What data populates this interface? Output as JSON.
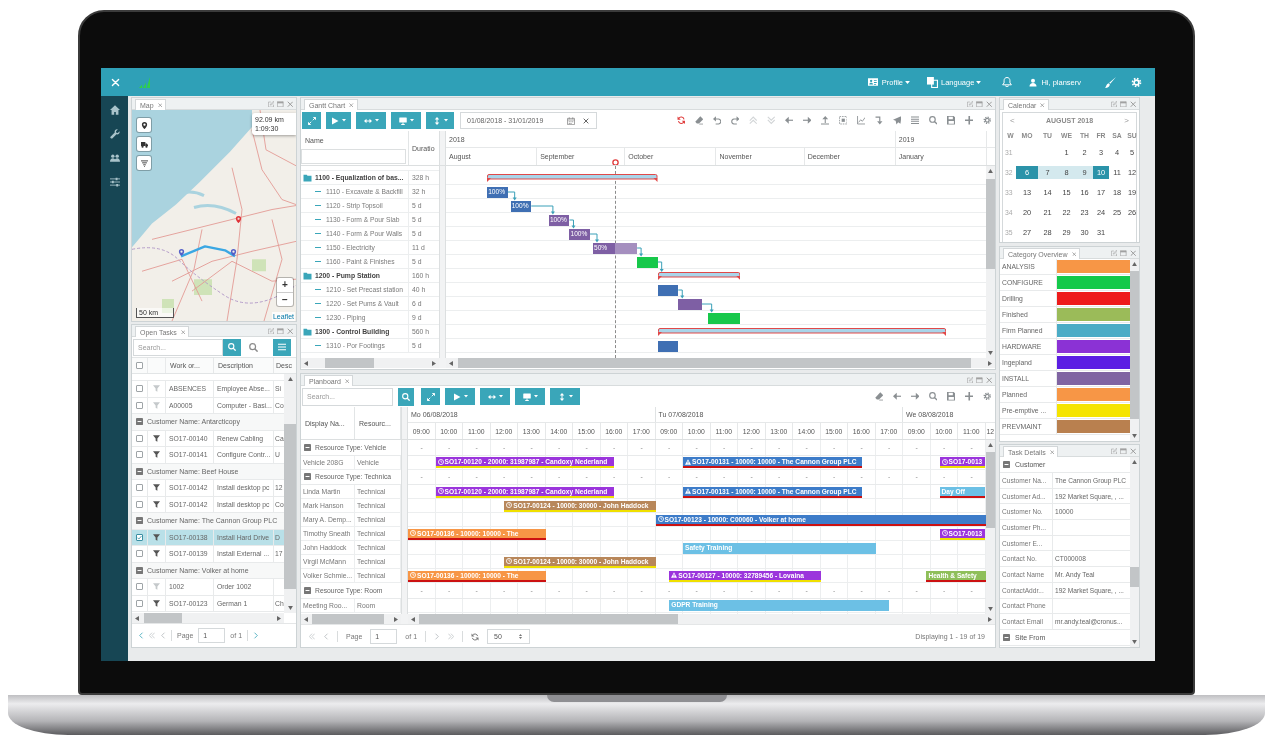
{
  "top_bar": {
    "menus": [
      {
        "label": "Profile"
      },
      {
        "label": "Language"
      }
    ],
    "user": "Hi, planserv"
  },
  "map_panel": {
    "title": "Map",
    "route_popup": {
      "distance": "92.09 km",
      "duration": "1:09:30"
    },
    "zoom_in": "+",
    "zoom_out": "−",
    "scale": "50 km",
    "attribution": "Leaflet"
  },
  "open_tasks": {
    "title": "Open Tasks",
    "search": {
      "placeholder": "Search..."
    },
    "header_checked": false,
    "columns": [
      "Work or...",
      "Description",
      "Desc"
    ],
    "rows": [
      {
        "kind": "task",
        "checked": false,
        "selected": false,
        "filter_active": false,
        "cells": [
          "ABSENCES",
          "Employee Abse...",
          "Si"
        ]
      },
      {
        "kind": "task",
        "checked": false,
        "selected": false,
        "filter_active": false,
        "cells": [
          "A00005",
          "Computer - Basi...",
          "Co"
        ]
      },
      {
        "kind": "group",
        "expanded": true,
        "label": "Customer Name: Antarcticopy"
      },
      {
        "kind": "task",
        "checked": false,
        "selected": false,
        "filter_active": true,
        "cells": [
          "SO17-00140",
          "Renew Cabling",
          "Ca"
        ]
      },
      {
        "kind": "task",
        "checked": false,
        "selected": false,
        "filter_active": true,
        "cells": [
          "SO17-00141",
          "Configure Contr...",
          "U"
        ]
      },
      {
        "kind": "group",
        "expanded": true,
        "label": "Customer Name: Beef House"
      },
      {
        "kind": "task",
        "checked": false,
        "selected": false,
        "filter_active": true,
        "cells": [
          "SO17-00142",
          "Install desktop pc",
          "12"
        ]
      },
      {
        "kind": "task",
        "checked": false,
        "selected": false,
        "filter_active": true,
        "cells": [
          "SO17-00142",
          "Install desktop pc",
          "Co"
        ]
      },
      {
        "kind": "group",
        "expanded": true,
        "label": "Customer Name: The Cannon Group PLC"
      },
      {
        "kind": "task",
        "checked": true,
        "selected": true,
        "filter_active": true,
        "cells": [
          "SO17-00138",
          "Install Hard Drive",
          "D"
        ]
      },
      {
        "kind": "task",
        "checked": false,
        "selected": false,
        "filter_active": true,
        "cells": [
          "SO17-00139",
          "Install External ...",
          "17"
        ]
      },
      {
        "kind": "group",
        "expanded": true,
        "label": "Customer Name: Volker at home"
      },
      {
        "kind": "task",
        "checked": false,
        "selected": false,
        "filter_active": false,
        "cells": [
          "1002",
          "Order 1002"
        ]
      },
      {
        "kind": "task",
        "checked": false,
        "selected": false,
        "filter_active": true,
        "cells": [
          "SO17-00123",
          "German 1",
          "Ch"
        ]
      }
    ],
    "pager": {
      "label": "Page",
      "page": "1",
      "of": "of 1"
    }
  },
  "gantt": {
    "title": "Gantt Chart",
    "date_range": "01/08/2018 - 31/01/2019",
    "tools": [
      {
        "disabled": false
      },
      {
        "disabled": false
      },
      {
        "disabled": false
      },
      {
        "disabled": false
      },
      {
        "disabled": true
      },
      {
        "disabled": true
      },
      {
        "disabled": false
      },
      {
        "disabled": false
      },
      {
        "disabled": false
      },
      {
        "disabled": false
      },
      {
        "disabled": false
      },
      {
        "disabled": false
      },
      {
        "disabled": false
      },
      {
        "disabled": false
      },
      {
        "disabled": false
      },
      {
        "disabled": false
      },
      {
        "disabled": false
      },
      {
        "disabled": false
      }
    ],
    "columns": [
      "Name",
      "Duratio"
    ],
    "timeline": {
      "years": [
        "2018",
        "2019"
      ],
      "months": [
        "August",
        "September",
        "October",
        "November",
        "December",
        "January"
      ]
    },
    "tasks": [
      {
        "name": "1100 - Equalization of bas...",
        "duration": "328 h",
        "children": [
          {
            "name": "1110 - Excavate & Backfill",
            "duration": "32 h",
            "color": "#3f6fb3",
            "level": 1,
            "progress_label": "100%"
          },
          {
            "name": "1120 - Strip Topsoil",
            "duration": "5 d",
            "color": "#3f6fb3",
            "level": 1,
            "progress_label": "100%"
          },
          {
            "name": "1130 - Form & Pour Slab",
            "duration": "5 d",
            "color": "#7e5fa4",
            "level": 1,
            "progress_label": "100%"
          },
          {
            "name": "1140 - Form & Pour Walls",
            "duration": "5 d",
            "color": "#7e5fa4",
            "level": 1,
            "progress_label": "100%"
          },
          {
            "name": "1150 - Electricity",
            "duration": "11 d",
            "color": "#7e5fa4",
            "level": 0.5,
            "progress_label": "50%"
          },
          {
            "name": "1160 - Paint & Finishes",
            "duration": "5 d",
            "color": "#17c84b"
          }
        ]
      },
      {
        "name": "1200 - Pump Station",
        "duration": "160 h",
        "children": [
          {
            "name": "1210 - Set Precast station",
            "duration": "40 h",
            "color": "#3f6fb3"
          },
          {
            "name": "1220 - Set Pums & Vault",
            "duration": "6 d",
            "color": "#7e5fa4"
          },
          {
            "name": "1230 - Piping",
            "duration": "9 d",
            "color": "#17c84b"
          }
        ]
      },
      {
        "name": "1300 - Control Building",
        "duration": "560 h",
        "children": [
          {
            "name": "1310 - Por Footings",
            "duration": "5 d",
            "color": "#3f6fb3"
          }
        ]
      }
    ]
  },
  "planboard": {
    "title": "Planboard",
    "search": {
      "placeholder": "Search..."
    },
    "columns": [
      "Display Na...",
      "Resourc..."
    ],
    "days": [
      {
        "label": "Mo 06/08/2018",
        "hours": [
          "09:00",
          "10:00",
          "11:00",
          "12:00",
          "13:00",
          "14:00",
          "15:00",
          "16:00",
          "17:00"
        ]
      },
      {
        "label": "Tu 07/08/2018",
        "hours": [
          "09:00",
          "10:00",
          "11:00",
          "12:00",
          "13:00",
          "14:00",
          "15:00",
          "16:00",
          "17:00"
        ]
      },
      {
        "label": "We 08/08/2018",
        "hours": [
          "09:00",
          "10:00",
          "11:00",
          "12"
        ]
      }
    ],
    "rows": [
      {
        "kind": "group",
        "expanded": true,
        "label": "Resource Type: Vehicle",
        "cells": [
          "-",
          "-",
          "-",
          "-",
          "-",
          "-",
          "-",
          "-",
          "-",
          "-",
          "-",
          "-",
          "-",
          "-",
          "-",
          "-",
          "-",
          "-",
          "-",
          "-",
          "-"
        ]
      },
      {
        "kind": "resource",
        "name": "Vehicle 208G",
        "type": "Vehicle",
        "events": [
          {
            "kind": "order",
            "label": "SO17-00120 - 20000: 31987987 - Candoxy Nederland",
            "color": "#9b35dc",
            "underline": {
              "color": "#f0e000"
            }
          },
          {
            "kind": "alert",
            "label": "SO17-00131 - 10000: 10000 - The Cannon Group PLC",
            "color": "#3d7cc9",
            "underline": {
              "color": "#cc1111"
            }
          },
          {
            "kind": "order",
            "label": "SO17-0013",
            "color": "#9b35dc",
            "underline": {
              "color": "#f0e000"
            }
          }
        ]
      },
      {
        "kind": "group",
        "expanded": true,
        "label": "Resource Type: Technica",
        "cells": [
          "-",
          "-",
          "-",
          "-",
          "-",
          "-",
          "-",
          "-",
          "-",
          "-",
          "-",
          "-",
          "-",
          "-",
          "-",
          "-",
          "-",
          "-",
          "-",
          "-",
          "-"
        ]
      },
      {
        "kind": "resource",
        "name": "Linda Martin",
        "type": "Technical",
        "events": [
          {
            "kind": "order",
            "label": "SO17-00120 - 20000: 31987987 - Candoxy Nederland",
            "color": "#9b35dc",
            "underline": {
              "color": "#f0e000"
            }
          },
          {
            "kind": "alert",
            "label": "SO17-00131 - 10000: 10000 - The Cannon Group PLC",
            "color": "#3d7cc9",
            "underline": {
              "color": "#cc1111"
            }
          },
          {
            "kind": "activity",
            "label": "Day Off",
            "color": "#6cc0e5",
            "underline": {
              "color": "#cc1111"
            }
          }
        ]
      },
      {
        "kind": "resource",
        "name": "Mark Hanson",
        "type": "Technical",
        "events": [
          {
            "kind": "order",
            "label": "SO17-00124 - 10000: 30000 - John Haddock",
            "color": "#b8875a",
            "underline": {
              "color": "#f0e000"
            }
          }
        ]
      },
      {
        "kind": "resource",
        "name": "Mary A. Demp...",
        "type": "Technical",
        "events": [
          {
            "kind": "order",
            "label": "SO17-00123 - 10000: C00060 - Volker at home",
            "color": "#3d7cc9",
            "underline": {
              "color": "#cc1111"
            }
          }
        ]
      },
      {
        "kind": "resource",
        "name": "Timothy Sneath",
        "type": "Technical",
        "events": [
          {
            "kind": "order",
            "label": "SO17-00136 - 10000: 10000 - The",
            "color": "#f79646",
            "underline": {
              "color": "#cc1111"
            }
          },
          {
            "kind": "order",
            "label": "SO17-0013",
            "color": "#9b35dc",
            "underline": {
              "color": "#f0e000"
            }
          }
        ]
      },
      {
        "kind": "resource",
        "name": "John Haddock",
        "type": "Technical",
        "events": [
          {
            "kind": "activity",
            "label": "Safety Training",
            "color": "#6cc0e5"
          }
        ]
      },
      {
        "kind": "resource",
        "name": "Virgil McMann",
        "type": "Technical",
        "events": [
          {
            "kind": "order",
            "label": "SO17-00124 - 10000: 30000 - John Haddock",
            "color": "#b8875a",
            "underline": {
              "color": "#f0e000"
            }
          }
        ]
      },
      {
        "kind": "resource",
        "name": "Volker Schmie...",
        "type": "Technical",
        "events": [
          {
            "kind": "order",
            "label": "SO17-00136 - 10000: 10000 - The",
            "color": "#f79646",
            "underline": {
              "color": "#cc1111"
            }
          },
          {
            "kind": "alert",
            "label": "SO17-00127 - 10000: 32789456 - Lovaina",
            "color": "#9b35dc",
            "underline": {
              "color": "#f0e000"
            }
          },
          {
            "kind": "activity",
            "label": "Health & Safety",
            "color": "#8fbf5a",
            "underline": {
              "color": "#cc1111"
            }
          }
        ]
      },
      {
        "kind": "group",
        "expanded": true,
        "label": "Resource Type: Room",
        "cells": [
          "-",
          "-",
          "-",
          "-",
          "-",
          "-",
          "-",
          "-",
          "-",
          "-",
          "-",
          "-",
          "-",
          "-",
          "-",
          "-",
          "-",
          "-",
          "-",
          "-",
          "-"
        ]
      },
      {
        "kind": "resource",
        "name": "Meeting Roo...",
        "type": "Room",
        "events": [
          {
            "kind": "activity",
            "label": "GDPR Training",
            "color": "#6cc0e5"
          }
        ]
      }
    ],
    "pager": {
      "label": "Page",
      "page": "1",
      "of": "of 1",
      "page_size": "50",
      "summary": "Displaying 1 - 19 of 19"
    }
  },
  "calendar": {
    "title": "Calendar",
    "prev": "<",
    "next": ">",
    "month": "AUGUST 2018",
    "weekdays": [
      "W",
      "MO",
      "TU",
      "WE",
      "TH",
      "FR",
      "SA",
      "SU"
    ],
    "weeks": [
      {
        "week": "31",
        "days": [
          {
            "label": "1",
            "selected": false,
            "in_range": false
          },
          {
            "label": "2",
            "selected": false,
            "in_range": false
          },
          {
            "label": "3",
            "selected": false,
            "in_range": false
          },
          {
            "label": "4",
            "selected": false,
            "in_range": false
          },
          {
            "label": "5",
            "selected": false,
            "in_range": false
          }
        ]
      },
      {
        "week": "32",
        "days": [
          {
            "label": "6",
            "selected": true,
            "in_range": false
          },
          {
            "label": "7",
            "selected": false,
            "in_range": true
          },
          {
            "label": "8",
            "selected": false,
            "in_range": true
          },
          {
            "label": "9",
            "selected": false,
            "in_range": true
          },
          {
            "label": "10",
            "selected": true,
            "in_range": false
          },
          {
            "label": "11",
            "selected": false,
            "in_range": false
          },
          {
            "label": "12",
            "selected": false,
            "in_range": false
          }
        ]
      },
      {
        "week": "33",
        "days": [
          {
            "label": "13",
            "selected": false,
            "in_range": false
          },
          {
            "label": "14",
            "selected": false,
            "in_range": false
          },
          {
            "label": "15",
            "selected": false,
            "in_range": false
          },
          {
            "label": "16",
            "selected": false,
            "in_range": false
          },
          {
            "label": "17",
            "selected": false,
            "in_range": false
          },
          {
            "label": "18",
            "selected": false,
            "in_range": false
          },
          {
            "label": "19",
            "selected": false,
            "in_range": false
          }
        ]
      },
      {
        "week": "34",
        "days": [
          {
            "label": "20",
            "selected": false,
            "in_range": false
          },
          {
            "label": "21",
            "selected": false,
            "in_range": false
          },
          {
            "label": "22",
            "selected": false,
            "in_range": false
          },
          {
            "label": "23",
            "selected": false,
            "in_range": false
          },
          {
            "label": "24",
            "selected": false,
            "in_range": false
          },
          {
            "label": "25",
            "selected": false,
            "in_range": false
          },
          {
            "label": "26",
            "selected": false,
            "in_range": false
          }
        ]
      },
      {
        "week": "35",
        "days": [
          {
            "label": "27",
            "selected": false,
            "in_range": false
          },
          {
            "label": "28",
            "selected": false,
            "in_range": false
          },
          {
            "label": "29",
            "selected": false,
            "in_range": false
          },
          {
            "label": "30",
            "selected": false,
            "in_range": false
          },
          {
            "label": "31",
            "selected": false,
            "in_range": false
          }
        ]
      }
    ]
  },
  "category_overview": {
    "title": "Category Overview",
    "items": [
      {
        "name": "ANALYSIS",
        "color": "#f79646"
      },
      {
        "name": "CONFIGURE",
        "color": "#14c94a"
      },
      {
        "name": "Drilling",
        "color": "#ee1b1b"
      },
      {
        "name": "Finished",
        "color": "#9bbb59"
      },
      {
        "name": "Firm Planned",
        "color": "#4bacc6"
      },
      {
        "name": "HARDWARE",
        "color": "#8b32d5"
      },
      {
        "name": "Ingepland",
        "color": "#5b1ee3"
      },
      {
        "name": "INSTALL",
        "color": "#8064a2"
      },
      {
        "name": "Planned",
        "color": "#f79646"
      },
      {
        "name": "Pre-emptive ...",
        "color": "#f5e400"
      },
      {
        "name": "PREVMAINT",
        "color": "#b9804f"
      }
    ]
  },
  "task_details": {
    "title": "Task Details",
    "sections": [
      {
        "label": "Customer",
        "expanded": true,
        "fields": [
          {
            "label": "Customer Na...",
            "value": "The Cannon Group PLC"
          },
          {
            "label": "Customer Ad...",
            "value": "192 Market Square, , ..."
          },
          {
            "label": "Customer No.",
            "value": "10000"
          },
          {
            "label": "Customer Ph..."
          },
          {
            "label": "Customer E..."
          },
          {
            "label": "Contact No.",
            "value": "CT000008"
          },
          {
            "label": "Contact Name",
            "value": "Mr. Andy Teal"
          },
          {
            "label": "ContactAddr...",
            "value": "192 Market Square, , ..."
          },
          {
            "label": "Contact Phone"
          },
          {
            "label": "Contact Email",
            "value": "mr.andy.teal@cronus..."
          }
        ]
      },
      {
        "label": "Site From",
        "expanded": true
      }
    ]
  }
}
